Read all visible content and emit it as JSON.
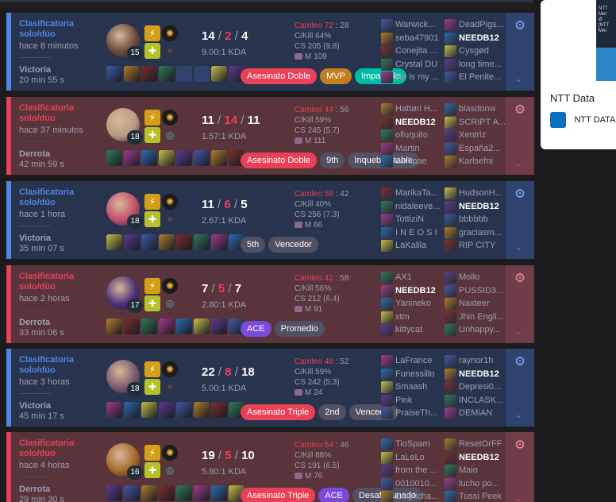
{
  "matches": [
    {
      "result_type": "win",
      "queue": "Clasificatoria solo/dúo",
      "ago": "hace 8 minutos",
      "result": "Victoria",
      "duration": "20 min 55 s",
      "champion_level": "15",
      "kills": "14",
      "deaths": "2",
      "assists": "4",
      "kda_ratio": "9.00:1 KDA",
      "pk_label": "Carrileo 72",
      "pk_value": "28",
      "kill_participation": "C/Kill 64%",
      "cs": "CS 205 (9.8)",
      "rank": "M 109",
      "tags": [
        {
          "label": "Asesinato Doble",
          "color": "red"
        },
        {
          "label": "MVP",
          "color": "orange"
        },
        {
          "label": "Imparable",
          "color": "green"
        }
      ],
      "team1": [
        "Warwick...",
        "seba47901",
        "Conejita ...",
        "Crystal DU",
        "He is my ..."
      ],
      "team2": [
        "DeadPigs...",
        "NEEDB12",
        "Cysgød",
        "long time...",
        "El Penite..."
      ]
    },
    {
      "result_type": "loss",
      "queue": "Clasificatoria solo/dúo",
      "ago": "hace 37 minutos",
      "result": "Derrota",
      "duration": "42 min 59 s",
      "champion_level": "18",
      "kills": "11",
      "deaths": "14",
      "assists": "11",
      "kda_ratio": "1.57:1 KDA",
      "pk_label": "Carrileo 44",
      "pk_value": "56",
      "kill_participation": "C/Kill 59%",
      "cs": "CS 245 (5.7)",
      "rank": "M 111",
      "tags": [
        {
          "label": "Asesinato Doble",
          "color": "red"
        },
        {
          "label": "9th",
          "color": "gray"
        },
        {
          "label": "Inquebrantable",
          "color": "gray"
        }
      ],
      "team1": [
        "Hattøri H...",
        "NEEDB12",
        "olluquito",
        "Martin",
        "darkpae"
      ],
      "team2": [
        "blasdonw",
        "SCRIPT A...",
        "Xentriz",
        "España2...",
        "Karlsefni"
      ]
    },
    {
      "result_type": "win",
      "queue": "Clasificatoria solo/dúo",
      "ago": "hace 1 hora",
      "result": "Victoria",
      "duration": "35 min 07 s",
      "champion_level": "18",
      "kills": "11",
      "deaths": "6",
      "assists": "5",
      "kda_ratio": "2.67:1 KDA",
      "pk_label": "Carrileo 58",
      "pk_value": "42",
      "kill_participation": "C/Kill 40%",
      "cs": "CS 256 (7.3)",
      "rank": "M 66",
      "tags": [
        {
          "label": "5th",
          "color": "gray"
        },
        {
          "label": "Vencedor",
          "color": "gray"
        }
      ],
      "team1": [
        "MarikaTa...",
        "nidaleeve...",
        "TottiziN",
        "I N E O S I",
        "LaKalila"
      ],
      "team2": [
        "HudsonH...",
        "NEEDB12",
        "bbbbbb",
        "graciasm...",
        "RIP CITY"
      ]
    },
    {
      "result_type": "loss",
      "queue": "Clasificatoria solo/dúo",
      "ago": "hace 2 horas",
      "result": "Derrota",
      "duration": "33 min 06 s",
      "champion_level": "17",
      "kills": "7",
      "deaths": "5",
      "assists": "7",
      "kda_ratio": "2.80:1 KDA",
      "pk_label": "Carrileo 42",
      "pk_value": "58",
      "kill_participation": "C/Kill 56%",
      "cs": "CS 212 (6.4)",
      "rank": "M 91",
      "tags": [
        {
          "label": "ACE",
          "color": "purple"
        },
        {
          "label": "Promedio",
          "color": "gray"
        }
      ],
      "team1": [
        "AX1",
        "NEEDB12",
        "Yanineko",
        "xtm",
        "kittycat"
      ],
      "team2": [
        "Mollo",
        "PUSSID3...",
        "Naxteer",
        "Jhin Engli...",
        "Unhappy..."
      ]
    },
    {
      "result_type": "win",
      "queue": "Clasificatoria solo/dúo",
      "ago": "hace 3 horas",
      "result": "Victoria",
      "duration": "45 min 17 s",
      "champion_level": "18",
      "kills": "22",
      "deaths": "8",
      "assists": "18",
      "kda_ratio": "5.00:1 KDA",
      "pk_label": "Carrileo 48",
      "pk_value": "52",
      "kill_participation": "C/Kill 59%",
      "cs": "CS 242 (5.3)",
      "rank": "M 24",
      "tags": [
        {
          "label": "Asesinato Triple",
          "color": "red"
        },
        {
          "label": "2nd",
          "color": "gray"
        },
        {
          "label": "Vencedor",
          "color": "gray"
        }
      ],
      "team1": [
        "LaFrance",
        "Funessillo",
        "Smaash",
        "Pink",
        "PraiseTh..."
      ],
      "team2": [
        "raynor1h",
        "NEEDB12",
        "Depresi0...",
        "INCLASK...",
        "DEMiAN"
      ]
    },
    {
      "result_type": "loss",
      "queue": "Clasificatoria solo/dúo",
      "ago": "hace 4 horas",
      "result": "Derrota",
      "duration": "29 min 30 s",
      "champion_level": "16",
      "kills": "19",
      "deaths": "5",
      "assists": "10",
      "kda_ratio": "5.80:1 KDA",
      "pk_label": "Carrileo 54",
      "pk_value": "46",
      "kill_participation": "C/Kill 88%",
      "cs": "CS 191 (6.5)",
      "rank": "M 76",
      "tags": [
        {
          "label": "Asesinato Triple",
          "color": "red"
        },
        {
          "label": "ACE",
          "color": "purple"
        },
        {
          "label": "Desafortunado",
          "color": "gray"
        }
      ],
      "team1": [
        "TioSpam",
        "LaLeLo",
        "from the ...",
        "0010010...",
        "Empilcha..."
      ],
      "team2": [
        "ResetOrFF",
        "NEEDB12",
        "Maio",
        "lucho po...",
        "Tussi Peek"
      ]
    }
  ],
  "me": "NEEDB12",
  "side_panel": {
    "title": "NTT Data",
    "source": "NTT DATA I"
  },
  "colors": {
    "win_bg": "#28344e",
    "loss_bg": "#59343b",
    "win_accent": "#5383e8",
    "loss_accent": "#e84057"
  }
}
